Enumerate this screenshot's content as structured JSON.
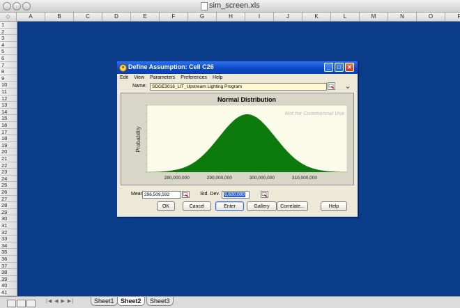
{
  "window": {
    "title": "sim_screen.xls"
  },
  "spreadsheet": {
    "corner_label": "◇",
    "columns": [
      "A",
      "B",
      "C",
      "D",
      "E",
      "F",
      "G",
      "H",
      "I",
      "J",
      "K",
      "L",
      "M",
      "N",
      "O",
      "P"
    ],
    "rows": [
      "1",
      "2",
      "3",
      "4",
      "5",
      "6",
      "7",
      "8",
      "9",
      "10",
      "11",
      "12",
      "13",
      "14",
      "15",
      "16",
      "17",
      "18",
      "19",
      "20",
      "21",
      "22",
      "23",
      "24",
      "25",
      "26",
      "27",
      "28",
      "29",
      "30",
      "31",
      "32",
      "33",
      "34",
      "35",
      "36",
      "37",
      "38",
      "39",
      "40",
      "41"
    ],
    "sheet_tabs": [
      "Sheet1",
      "Sheet2",
      "Sheet3"
    ],
    "active_sheet": "Sheet2",
    "nav_arrows": "|◀ ◀ ▶ ▶|",
    "background_color": "#0a3c8a"
  },
  "dialog": {
    "title": "Define Assumption: Cell C26",
    "menu": [
      "Edit",
      "View",
      "Parameters",
      "Preferences",
      "Help"
    ],
    "name_label": "Name:",
    "name_value": "SDGE3016_LIT_Upstream Lighting Program",
    "mean_label": "Mean",
    "mean_value": "296,509,592",
    "std_label": "Std. Dev.",
    "std_value": "6,600,000",
    "buttons": [
      "OK",
      "Cancel",
      "Enter",
      "Gallery",
      "Correlate...",
      "Help"
    ]
  },
  "chart_data": {
    "type": "area",
    "title": "Normal Distribution",
    "watermark": "Not for Commercial Use",
    "ylabel": "Probability",
    "xlabel": "",
    "distribution": "normal",
    "mean": 296509592,
    "std_dev": 6600000,
    "x_ticks": [
      280000000,
      290000000,
      300000000,
      310000000
    ],
    "x_tick_labels": [
      "280,000,000",
      "290,000,000",
      "300,000,000",
      "310,000,000"
    ],
    "xlim": [
      273000000,
      320000000
    ],
    "fill_color": "#0d7a0d",
    "plot_background": "#fbfbea"
  }
}
